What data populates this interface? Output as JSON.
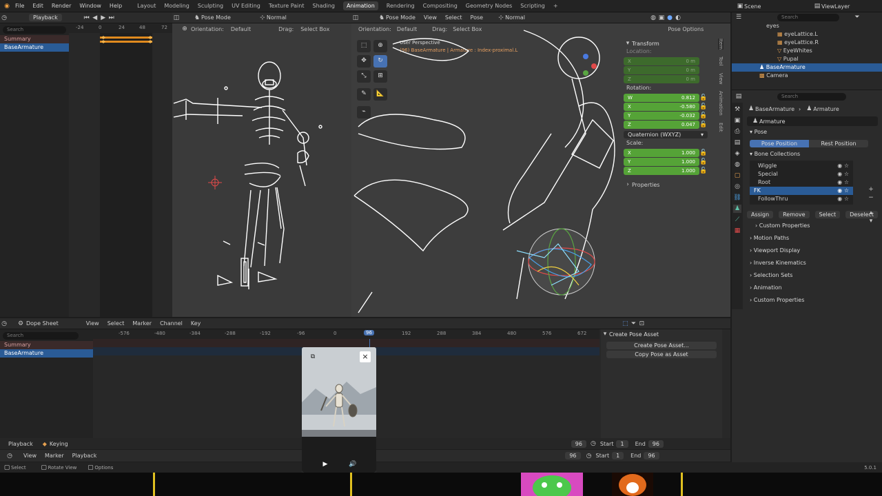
{
  "topbar": {
    "menu": [
      "File",
      "Edit",
      "Render",
      "Window",
      "Help"
    ],
    "workspaces": [
      "Layout",
      "Modeling",
      "Sculpting",
      "UV Editing",
      "Texture Paint",
      "Shading",
      "Animation",
      "Rendering",
      "Compositing",
      "Geometry Nodes",
      "Scripting"
    ],
    "active_workspace": "Animation",
    "add": "+",
    "scene": "Scene",
    "view_layer": "ViewLayer"
  },
  "timeline_top": {
    "mode": "Playback",
    "search_placeholder": "Search",
    "ticks": [
      "-24",
      "0",
      "24",
      "48",
      "72"
    ],
    "channels": [
      "Summary",
      "BaseArmature"
    ]
  },
  "left_viewport": {
    "orientation_label": "Orientation:",
    "orientation": "Default",
    "drag_label": "Drag:",
    "drag": "Select Box",
    "mode": "Pose Mode",
    "transform": "Normal"
  },
  "main_viewport": {
    "mode": "Pose Mode",
    "menus": [
      "View",
      "Select",
      "Pose"
    ],
    "transform": "Normal",
    "orientation_label": "Orientation:",
    "orientation": "Default",
    "drag_label": "Drag:",
    "drag": "Select Box",
    "pose_options": "Pose Options",
    "overlay_line1": "User Perspective",
    "overlay_line2": "(96) BaseArmature | Armature : Index-proximal.L"
  },
  "npanel": {
    "title": "Transform",
    "location_label": "Location:",
    "location": [
      {
        "axis": "X",
        "value": "0 m"
      },
      {
        "axis": "Y",
        "value": "0 m"
      },
      {
        "axis": "Z",
        "value": "0 m"
      }
    ],
    "rotation_label": "Rotation:",
    "rotation": [
      {
        "axis": "W",
        "value": "0.812"
      },
      {
        "axis": "X",
        "value": "-0.580"
      },
      {
        "axis": "Y",
        "value": "-0.032"
      },
      {
        "axis": "Z",
        "value": "0.047"
      }
    ],
    "rotation_mode": "Quaternion (WXYZ)",
    "scale_label": "Scale:",
    "scale": [
      {
        "axis": "X",
        "value": "1.000"
      },
      {
        "axis": "Y",
        "value": "1.000"
      },
      {
        "axis": "Z",
        "value": "1.000"
      }
    ],
    "properties": "Properties",
    "tabs": [
      "Item",
      "Tool",
      "View",
      "Animation",
      "Edit"
    ]
  },
  "outliner": {
    "search_placeholder": "Search",
    "items": [
      "eyes",
      "eyeLattice.L",
      "eyeLattice.R",
      "EyeWhites",
      "Pupal",
      "BaseArmature",
      "Camera"
    ],
    "selected": "BaseArmature"
  },
  "properties": {
    "search_placeholder": "Search",
    "breadcrumb_object": "BaseArmature",
    "breadcrumb_data": "Armature",
    "datablock": "Armature",
    "pose_header": "Pose",
    "pose_position": "Pose Position",
    "rest_position": "Rest Position",
    "bone_collections_header": "Bone Collections",
    "collections": [
      "Wiggle",
      "Special",
      "Root",
      "FK",
      "FollowThru"
    ],
    "selected_collection": "FK",
    "assign": "Assign",
    "remove": "Remove",
    "select": "Select",
    "deselect": "Deselect",
    "sections": [
      "Custom Properties",
      "Motion Paths",
      "Viewport Display",
      "Inverse Kinematics",
      "Selection Sets",
      "Animation",
      "Custom Properties"
    ]
  },
  "dopesheet": {
    "mode": "Dope Sheet",
    "menus": [
      "View",
      "Select",
      "Marker",
      "Channel",
      "Key"
    ],
    "search_placeholder": "Search",
    "ticks": [
      "-576",
      "-480",
      "-384",
      "-288",
      "-192",
      "-96",
      "0",
      "96",
      "192",
      "288",
      "384",
      "480",
      "576",
      "672"
    ],
    "current_frame": "96",
    "channels": [
      "Summary",
      "BaseArmature"
    ],
    "pose_header": "Create Pose Asset",
    "create_pose_asset": "Create Pose Asset...",
    "copy_pose_asset": "Copy Pose as Asset",
    "playback": "Playback",
    "keying": "Keying",
    "frame": "96",
    "start_label": "Start",
    "start": "1",
    "end_label": "End",
    "end": "96"
  },
  "timeline_bottom": {
    "menus": [
      "View",
      "Marker",
      "Playback"
    ],
    "frame": "96",
    "start_label": "Start",
    "start": "1",
    "end_label": "End",
    "end": "96"
  },
  "statusbar": {
    "select": "Select",
    "rotate_view": "Rotate View",
    "options": "Options",
    "version": "5.0.1"
  }
}
